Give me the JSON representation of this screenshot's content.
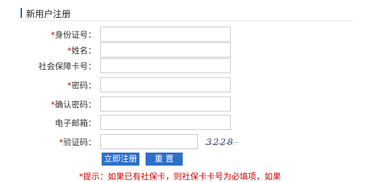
{
  "header": {
    "title": "新用户注册"
  },
  "form": {
    "id_number": {
      "required_mark": "*",
      "label": "身份证号："
    },
    "name": {
      "required_mark": "*",
      "label": "姓名："
    },
    "social_card": {
      "required_mark": "",
      "label": "社会保障卡号："
    },
    "password": {
      "required_mark": "*",
      "label": "密码："
    },
    "confirm_password": {
      "required_mark": "*",
      "label": "确认密码："
    },
    "email": {
      "required_mark": "",
      "label": "电子邮箱："
    },
    "captcha": {
      "required_mark": "*",
      "label": "验证码：",
      "image_text": "3228"
    }
  },
  "buttons": {
    "register": "立即注册",
    "reset": "重 置"
  },
  "tip": "*提示：如果已有社保卡，则社保卡卡号为必填项，如果"
}
